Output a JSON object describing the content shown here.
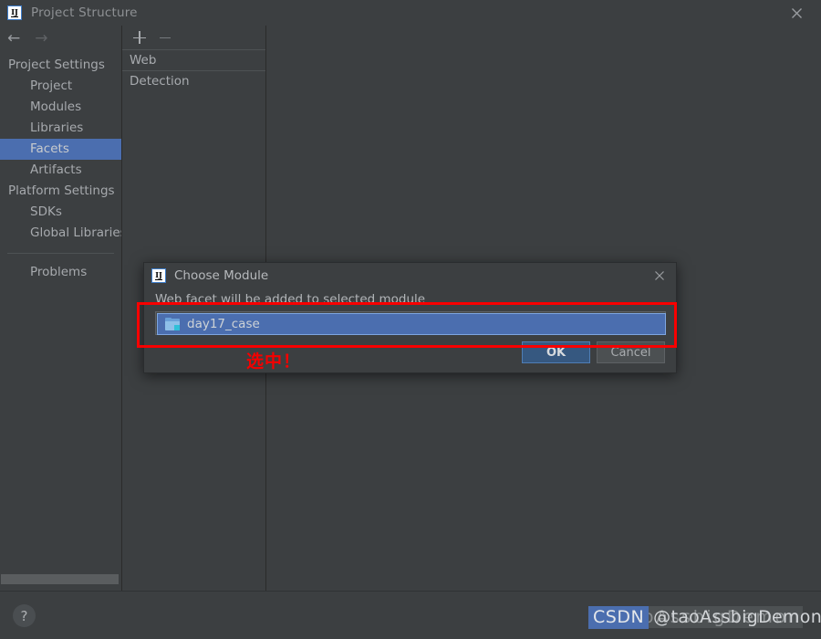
{
  "window": {
    "title": "Project Structure",
    "icon": "intellij-idea-icon",
    "close_label": "✕"
  },
  "nav": {
    "back_icon": "arrow-left-icon",
    "forward_icon": "arrow-right-icon",
    "back_label": "←",
    "forward_label": "→"
  },
  "sidebar": {
    "groups": [
      {
        "header": "Project Settings",
        "items": [
          {
            "label": "Project",
            "selected": false
          },
          {
            "label": "Modules",
            "selected": false
          },
          {
            "label": "Libraries",
            "selected": false
          },
          {
            "label": "Facets",
            "selected": true
          },
          {
            "label": "Artifacts",
            "selected": false
          }
        ]
      },
      {
        "header": "Platform Settings",
        "items": [
          {
            "label": "SDKs",
            "selected": false
          },
          {
            "label": "Global Libraries",
            "selected": false
          }
        ]
      }
    ],
    "problems": {
      "label": "Problems",
      "selected": false
    }
  },
  "facet_panel": {
    "toolbar": {
      "add_icon": "plus-icon",
      "remove_icon": "minus-icon"
    },
    "rows": [
      {
        "label": "Web"
      },
      {
        "label": "Detection"
      }
    ]
  },
  "bottom": {
    "help_label": "?",
    "help_icon": "question-mark-icon"
  },
  "dialog": {
    "icon": "intellij-idea-icon",
    "title": "Choose Module",
    "close_label": "✕",
    "description": "Web facet will be added to selected module",
    "modules": [
      {
        "label": "day17_case",
        "icon": "module-folder-icon",
        "selected": true
      }
    ],
    "buttons": {
      "ok": "OK",
      "cancel": "Cancel"
    }
  },
  "annotation": {
    "text": "选中！",
    "color": "#f50000",
    "rect_color": "#f80000"
  },
  "watermark": {
    "badge": "CSDN",
    "user": "@taoAssbigDemon",
    "ghost": "@taoAssbigDemon",
    "badge_color": "#4b6eaf"
  }
}
